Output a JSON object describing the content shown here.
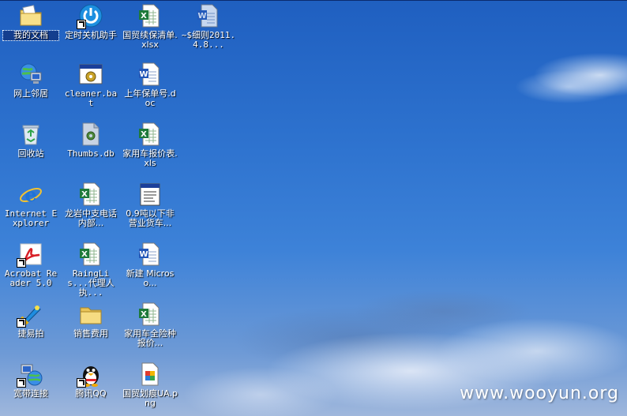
{
  "desktop": {
    "icons": [
      {
        "label": "我的文档",
        "icon": "my-documents-icon"
      },
      {
        "label": "定时关机助手",
        "icon": "power-icon"
      },
      {
        "label": "国贸续保清单.xlsx",
        "icon": "excel-file-icon"
      },
      {
        "label": "~$细则2011.4.8...",
        "icon": "word-file-icon"
      },
      {
        "label": "网上邻居",
        "icon": "network-icon"
      },
      {
        "label": "cleaner.bat",
        "icon": "batch-file-icon"
      },
      {
        "label": "上年保单号.doc",
        "icon": "word-file-icon"
      },
      {
        "label": "回收站",
        "icon": "recycle-bin-icon"
      },
      {
        "label": "Thumbs.db",
        "icon": "system-file-icon"
      },
      {
        "label": "家用车报价表.xls",
        "icon": "excel-file-icon"
      },
      {
        "label": "Internet Explorer",
        "icon": "internet-explorer-icon"
      },
      {
        "label": "龙岩中支电话内部...",
        "icon": "excel-file-icon"
      },
      {
        "label": "0.9吨以下非营业货车...",
        "icon": "text-file-icon"
      },
      {
        "label": "Acrobat Reader 5.0",
        "icon": "acrobat-icon"
      },
      {
        "label": "RaingLis...代理人执...",
        "icon": "excel-file-icon"
      },
      {
        "label": "新建 Microso...",
        "icon": "word-file-icon"
      },
      {
        "label": "捷易拍",
        "icon": "camera-app-icon"
      },
      {
        "label": "销售费用",
        "icon": "folder-icon"
      },
      {
        "label": "家用车全险种报价...",
        "icon": "excel-file-icon"
      },
      {
        "label": "宽带连接",
        "icon": "broadband-icon"
      },
      {
        "label": "腾讯QQ",
        "icon": "qq-penguin-icon"
      },
      {
        "label": "国贸划痕UA.png",
        "icon": "image-file-icon"
      }
    ]
  },
  "watermark": "www.wooyun.org",
  "colors": {
    "label_text": "#ffffff",
    "selection": "#0a246a"
  }
}
